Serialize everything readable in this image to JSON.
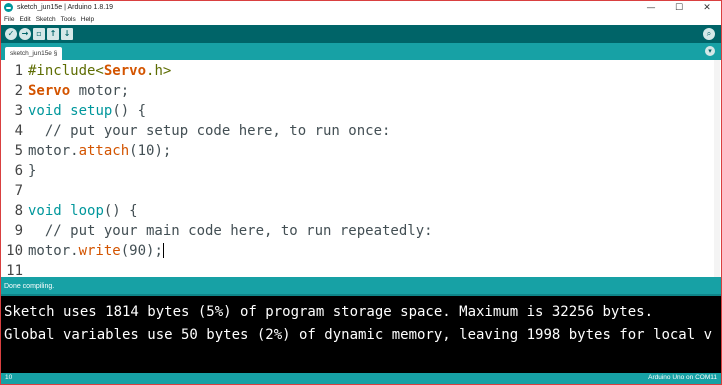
{
  "window": {
    "title": "sketch_jun15e | Arduino 1.8.19",
    "controls": {
      "minimize": "—",
      "maximize": "☐",
      "close": "✕"
    }
  },
  "menu": [
    "File",
    "Edit",
    "Sketch",
    "Tools",
    "Help"
  ],
  "toolbar": {
    "verify_icon": "✓",
    "upload_icon": "→",
    "new_icon": "▫",
    "open_icon": "↑",
    "save_icon": "↓",
    "serial_monitor_icon": "⌕"
  },
  "tabs": {
    "active": "sketch_jun15e §",
    "menu_icon": "▾"
  },
  "editor": {
    "line_numbers": [
      "1",
      "2",
      "3",
      "4",
      "5",
      "6",
      "7",
      "8",
      "9",
      "10",
      "11"
    ],
    "lines": [
      {
        "parts": [
          {
            "t": "#include<",
            "c": "pp"
          },
          {
            "t": "Servo",
            "c": "kw-lib"
          },
          {
            "t": ".h>",
            "c": "pp"
          }
        ]
      },
      {
        "parts": [
          {
            "t": "Servo",
            "c": "kw-lib"
          },
          {
            "t": " motor;",
            "c": ""
          }
        ]
      },
      {
        "parts": [
          {
            "t": "void",
            "c": "kw-type"
          },
          {
            "t": " ",
            "c": ""
          },
          {
            "t": "setup",
            "c": "kw-type"
          },
          {
            "t": "() {",
            "c": ""
          }
        ]
      },
      {
        "parts": [
          {
            "t": "  // put your setup code here, to run once:",
            "c": "cm"
          }
        ]
      },
      {
        "parts": [
          {
            "t": "motor.",
            "c": ""
          },
          {
            "t": "attach",
            "c": "kw-fn"
          },
          {
            "t": "(10);",
            "c": ""
          }
        ]
      },
      {
        "parts": [
          {
            "t": "}",
            "c": ""
          }
        ]
      },
      {
        "parts": []
      },
      {
        "parts": [
          {
            "t": "void",
            "c": "kw-type"
          },
          {
            "t": " ",
            "c": ""
          },
          {
            "t": "loop",
            "c": "kw-type"
          },
          {
            "t": "() {",
            "c": ""
          }
        ]
      },
      {
        "parts": [
          {
            "t": "  // put your main code here, to run repeatedly:",
            "c": "cm"
          }
        ]
      },
      {
        "parts": [
          {
            "t": "motor.",
            "c": ""
          },
          {
            "t": "write",
            "c": "kw-fn"
          },
          {
            "t": "(90);",
            "c": ""
          }
        ],
        "caret": true
      },
      {
        "parts": []
      }
    ]
  },
  "status": {
    "message": "Done compiling."
  },
  "console": {
    "lines": [
      "Sketch uses 1814 bytes (5%) of program storage space. Maximum is 32256 bytes.",
      "Global variables use 50 bytes (2%) of dynamic memory, leaving 1998 bytes for local v"
    ]
  },
  "footer": {
    "line_number": "10",
    "board": "Arduino Uno on COM11"
  },
  "colors": {
    "toolbar": "#006468",
    "tabbar": "#17a1a5",
    "keyword": "#00979c",
    "library": "#d35400",
    "preprocessor": "#5e6d03",
    "frame_border": "#d94040"
  }
}
